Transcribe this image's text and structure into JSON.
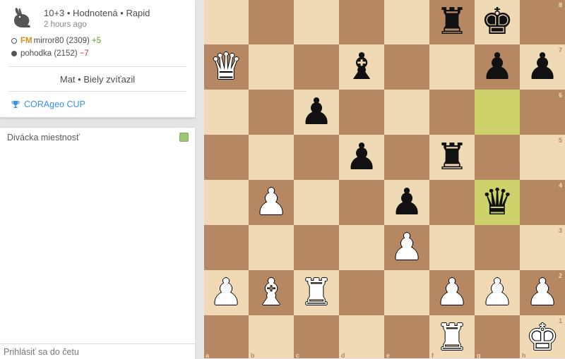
{
  "game": {
    "time_control": "10+3",
    "rated": "Hodnotená",
    "speed": "Rapid",
    "meta_line": "10+3 • Hodnotená • Rapid",
    "time_ago": "2 hours ago",
    "white": {
      "title": "FM",
      "name": "mirror80",
      "rating": "(2309)",
      "diff": "+5"
    },
    "black": {
      "name": "pohodka",
      "rating": "(2152)",
      "diff": "−7"
    },
    "result": "Mat • Biely zvíťazil",
    "tournament": "CORAgeo CUP"
  },
  "chat": {
    "title": "Divácka miestnosť",
    "input_placeholder": "Prihlásiť sa do četu"
  },
  "board": {
    "files": [
      "a",
      "b",
      "c",
      "d",
      "e",
      "f",
      "g",
      "h"
    ],
    "ranks": [
      "8",
      "7",
      "6",
      "5",
      "4",
      "3",
      "2",
      "1"
    ],
    "colors": {
      "light": "#f0d9b5",
      "dark": "#b58863",
      "highlight": "#cdd26a"
    },
    "highlight": [
      "g6",
      "g4"
    ],
    "pieces": [
      {
        "sq": "f8",
        "color": "b",
        "type": "rook"
      },
      {
        "sq": "g8",
        "color": "b",
        "type": "king"
      },
      {
        "sq": "a7",
        "color": "w",
        "type": "queen"
      },
      {
        "sq": "d7",
        "color": "b",
        "type": "bishop"
      },
      {
        "sq": "g7",
        "color": "b",
        "type": "pawn"
      },
      {
        "sq": "h7",
        "color": "b",
        "type": "pawn"
      },
      {
        "sq": "c6",
        "color": "b",
        "type": "pawn"
      },
      {
        "sq": "d5",
        "color": "b",
        "type": "pawn"
      },
      {
        "sq": "f5",
        "color": "b",
        "type": "rook"
      },
      {
        "sq": "b4",
        "color": "w",
        "type": "pawn"
      },
      {
        "sq": "e4",
        "color": "b",
        "type": "pawn"
      },
      {
        "sq": "g4",
        "color": "b",
        "type": "queen"
      },
      {
        "sq": "e3",
        "color": "w",
        "type": "pawn"
      },
      {
        "sq": "a2",
        "color": "w",
        "type": "pawn"
      },
      {
        "sq": "b2",
        "color": "w",
        "type": "bishop"
      },
      {
        "sq": "c2",
        "color": "w",
        "type": "rook"
      },
      {
        "sq": "f2",
        "color": "w",
        "type": "pawn"
      },
      {
        "sq": "g2",
        "color": "w",
        "type": "pawn"
      },
      {
        "sq": "h2",
        "color": "w",
        "type": "pawn"
      },
      {
        "sq": "f1",
        "color": "w",
        "type": "rook"
      },
      {
        "sq": "h1",
        "color": "w",
        "type": "king"
      }
    ]
  }
}
